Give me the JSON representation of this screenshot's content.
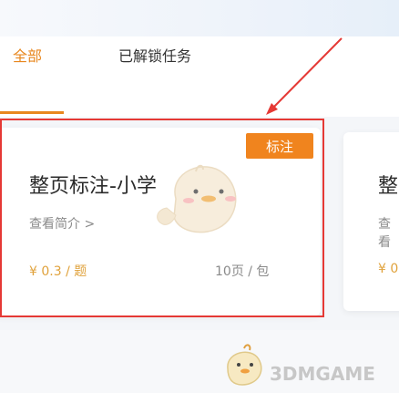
{
  "tabs": [
    {
      "label": "全部",
      "active": true
    },
    {
      "label": "已解锁任务",
      "active": false
    }
  ],
  "card": {
    "tag": "标注",
    "title": "整页标注-小学",
    "link": "查看简介 >",
    "price": "¥ 0.3 / 题",
    "count": "10页 / 包"
  },
  "next_card": {
    "title": "整",
    "link": "查看",
    "price": "¥ 0"
  },
  "watermark": "3DMGAME",
  "colors": {
    "accent": "#e8871e",
    "tag_bg": "#f0841e",
    "highlight": "#e53935",
    "price": "#e0a23c"
  }
}
